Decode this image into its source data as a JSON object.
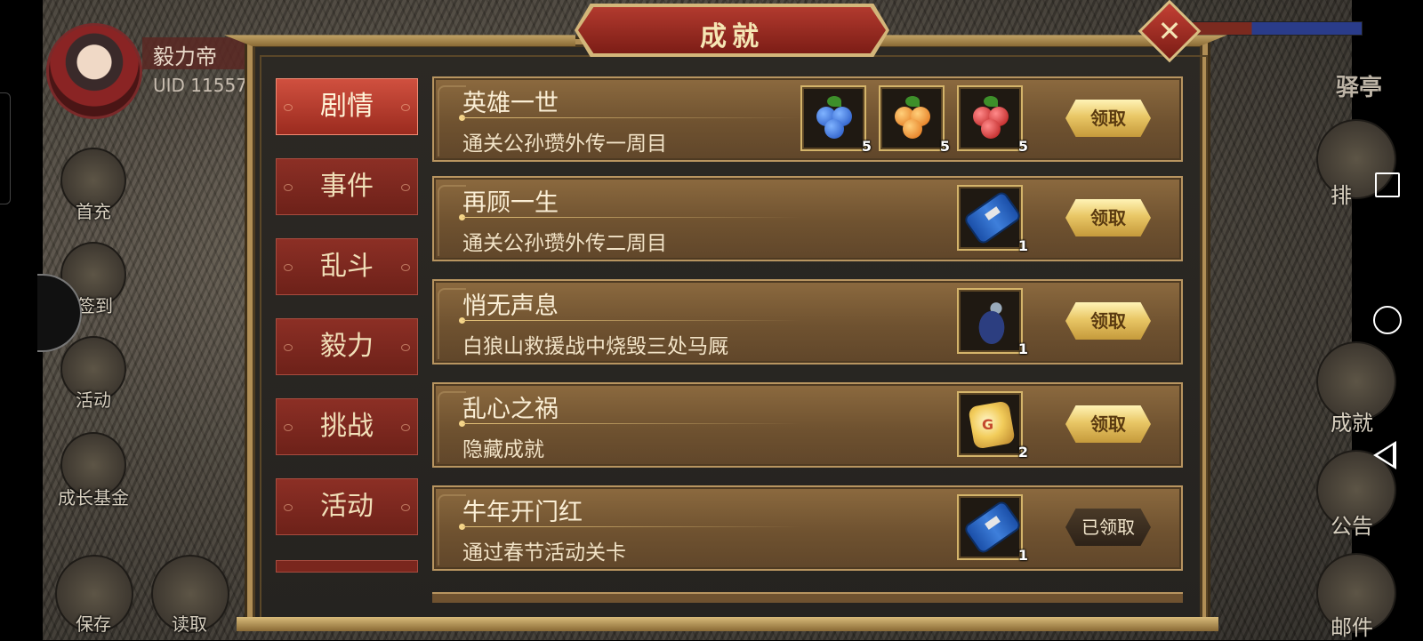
{
  "player": {
    "name": "毅力帝",
    "uid": "UID 11557"
  },
  "left_menu": [
    {
      "label": "首充",
      "icon": "gift-icon"
    },
    {
      "label": "签到",
      "icon": "book-icon"
    },
    {
      "label": "活动",
      "icon": "event-icon"
    },
    {
      "label": "成长基金",
      "icon": "plant-icon"
    }
  ],
  "bottom_menu": [
    {
      "label": "保存",
      "icon": "save-icon"
    },
    {
      "label": "读取",
      "icon": "load-icon"
    }
  ],
  "right_menu": {
    "post_label": "驿亭",
    "items": [
      {
        "label": "排",
        "icon": "rank-icon"
      },
      {
        "label": "成就",
        "icon": "trophy-icon"
      },
      {
        "label": "公告",
        "icon": "notice-icon"
      },
      {
        "label": "邮件",
        "icon": "mail-icon"
      }
    ]
  },
  "dialog": {
    "title": "成就",
    "close_glyph": "✕",
    "categories": [
      {
        "label": "剧情",
        "active": true
      },
      {
        "label": "事件",
        "active": false
      },
      {
        "label": "乱斗",
        "active": false
      },
      {
        "label": "毅力",
        "active": false
      },
      {
        "label": "挑战",
        "active": false
      },
      {
        "label": "活动",
        "active": false
      }
    ],
    "achievements": [
      {
        "title": "英雄一世",
        "desc": "通关公孙瓒外传一周目",
        "rewards": [
          {
            "icon": "blue-fruit-icon",
            "qty": "5",
            "color": "#2f6fe0"
          },
          {
            "icon": "orange-fruit-icon",
            "qty": "5",
            "color": "#ef8a2a"
          },
          {
            "icon": "red-fruit-icon",
            "qty": "5",
            "color": "#d62424"
          }
        ],
        "button": "领取",
        "claimed": false
      },
      {
        "title": "再顾一生",
        "desc": "通关公孙瓒外传二周目",
        "rewards": [
          {
            "icon": "blue-scroll-icon",
            "qty": "1"
          }
        ],
        "button": "领取",
        "claimed": false
      },
      {
        "title": "悄无声息",
        "desc": "白狼山救援战中烧毁三处马厩",
        "rewards": [
          {
            "icon": "cavalry-unit-icon",
            "qty": "1"
          }
        ],
        "button": "领取",
        "claimed": false
      },
      {
        "title": "乱心之祸",
        "desc": "隐藏成就",
        "rewards": [
          {
            "icon": "gold-coin-icon",
            "qty": "2",
            "mark": "G"
          }
        ],
        "button": "领取",
        "claimed": false
      },
      {
        "title": "牛年开门红",
        "desc": "通过春节活动关卡",
        "rewards": [
          {
            "icon": "blue-scroll-icon",
            "qty": "1"
          }
        ],
        "button": "已领取",
        "claimed": true
      }
    ]
  },
  "colors": {
    "frame_gold": "#b08e55",
    "tab_red": "#8c2f25",
    "tab_active": "#d0503f",
    "row_brown": "#6f5230",
    "claim_gold": "#e9c766"
  }
}
